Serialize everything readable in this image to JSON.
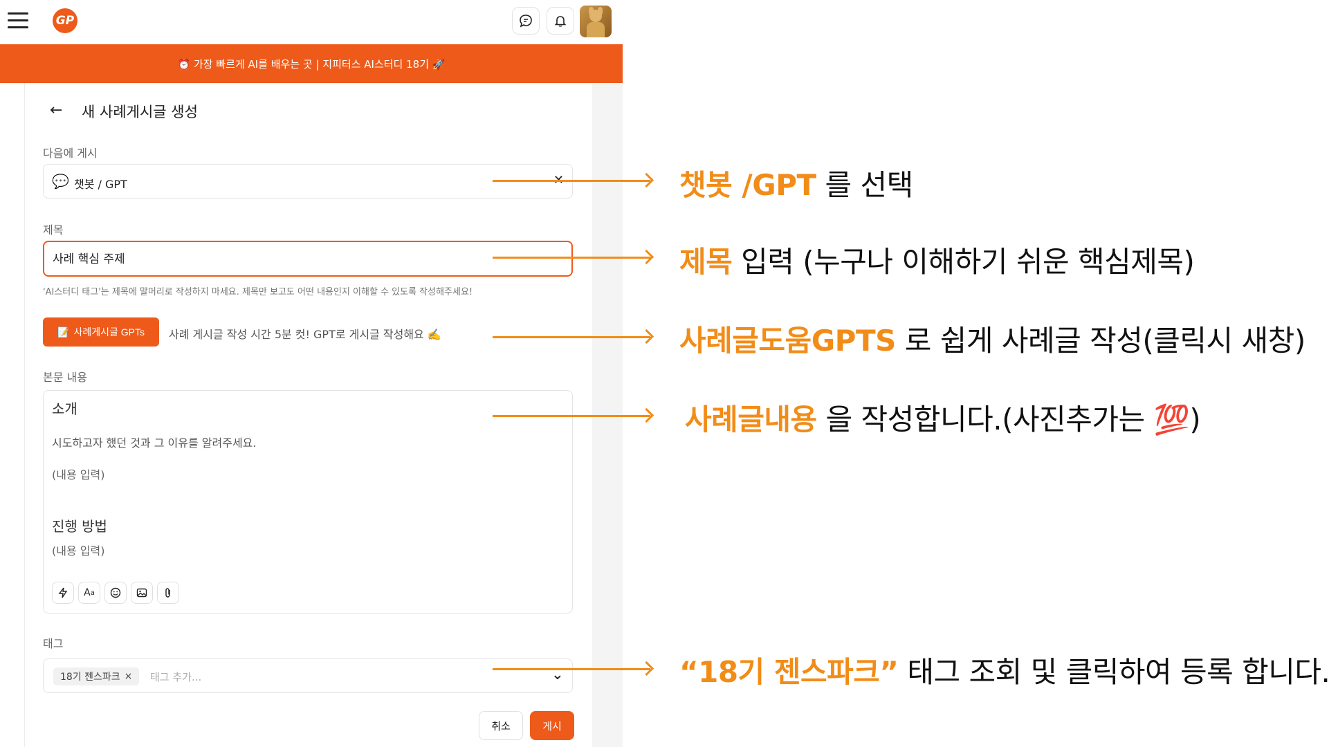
{
  "header": {
    "logo_text": "GP",
    "icons": [
      "menu-icon",
      "chat-icon",
      "bell-icon"
    ]
  },
  "banner": {
    "text": "⏰ 가장 빠르게 AI를 배우는 곳 | 지피터스 AI스터디 18기 🚀"
  },
  "page": {
    "title": "새 사례게시글 생성",
    "board_label": "다음에 게시",
    "board_value": "챗봇 / GPT",
    "title_label": "제목",
    "title_value": "사례 핵심 주제",
    "title_hint": "'AI스터디 태그'는 제목에 말머리로 작성하지 마세요. 제목만 보고도 어떤 내용인지 이해할 수 있도록 작성해주세요!",
    "gpts_button": "사례게시글 GPTs",
    "gpts_desc": "사례 게시글 작성 시간 5분 컷! GPT로 게시글 작성해요 ✍️",
    "body_label": "본문 내용",
    "body": {
      "heading1": "소개",
      "paragraph1": "시도하고자 했던 것과 그 이유를 알려주세요.",
      "placeholder1": "(내용 입력)",
      "heading2": "진행 방법",
      "placeholder2": "(내용 입력)"
    },
    "tag_label": "태그",
    "tag_chip": "18기 젠스파크",
    "tag_placeholder": "태그 추가...",
    "cancel_button": "취소",
    "post_button": "게시"
  },
  "annotations": [
    {
      "highlight": "챗봇 /GPT",
      "rest": " 를 선택"
    },
    {
      "highlight": "제목",
      "rest": "  입력 (누구나 이해하기 쉬운 핵심제목)"
    },
    {
      "highlight": "사례글도움GPTS",
      "rest": "  로 쉽게 사례글 작성(클릭시 새창)"
    },
    {
      "highlight": "사례글내용",
      "rest": "  을 작성합니다.(사진추가는 💯)"
    },
    {
      "highlight": "“18기 젠스파크”",
      "rest": " 태그 조회 및 클릭하여 등록 합니다."
    }
  ],
  "colors": {
    "brand": "#ee5a1a",
    "annotation": "#f28c18"
  }
}
